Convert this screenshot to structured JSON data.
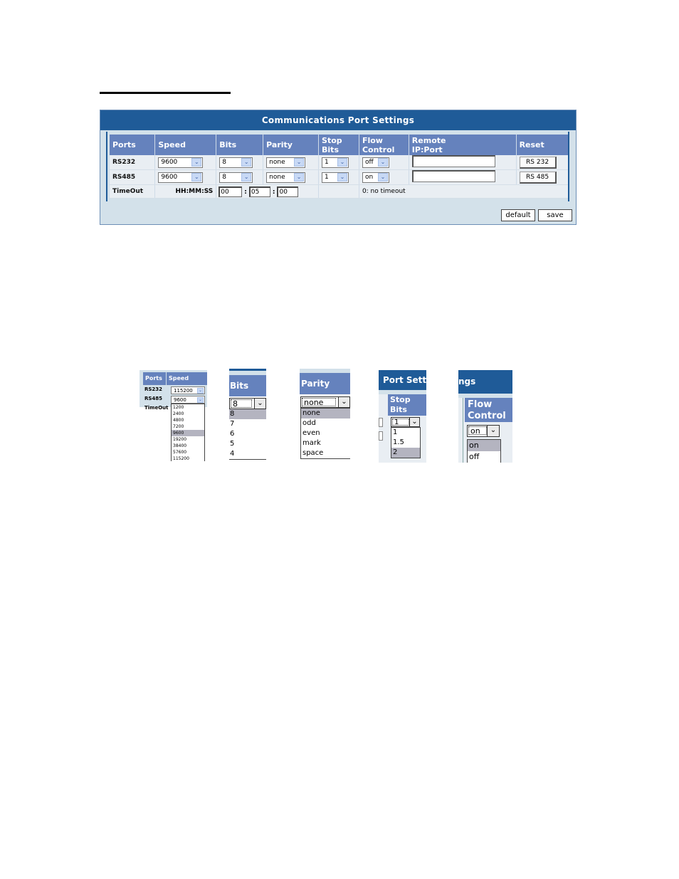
{
  "panel": {
    "title": "Communications Port Settings",
    "columns": [
      "Ports",
      "Speed",
      "Bits",
      "Parity",
      "Stop\nBits",
      "Flow\nControl",
      "Remote\nIP:Port",
      "Reset"
    ],
    "col_lines": {
      "stop": [
        "Stop",
        "Bits"
      ],
      "flow": [
        "Flow",
        "Control"
      ],
      "remote": [
        "Remote",
        "IP:Port"
      ]
    },
    "rows": [
      {
        "port": "RS232",
        "speed": "9600",
        "bits": "8",
        "parity": "none",
        "stop_bits": "1",
        "flow_control": "off",
        "remote_ip_port": "",
        "reset_label": "RS 232"
      },
      {
        "port": "RS485",
        "speed": "9600",
        "bits": "8",
        "parity": "none",
        "stop_bits": "1",
        "flow_control": "on",
        "remote_ip_port": "",
        "reset_label": "RS 485"
      }
    ],
    "timeout": {
      "label": "TimeOut",
      "format": "HH:MM:SS",
      "hh": "00",
      "mm": "05",
      "ss": "00",
      "separator": ":",
      "note": "0: no timeout"
    },
    "buttons": {
      "default": "default",
      "save": "save"
    }
  },
  "dropdown_examples": {
    "speed": {
      "header_ports": "Ports",
      "header_speed": "Speed",
      "rows": [
        {
          "port": "RS232",
          "value": "115200"
        },
        {
          "port": "RS485",
          "value": "9600"
        },
        {
          "port": "TimeOut",
          "value": ""
        }
      ],
      "options": [
        "1200",
        "2400",
        "4800",
        "7200",
        "9600",
        "19200",
        "38400",
        "57600",
        "115200"
      ],
      "highlighted": "9600"
    },
    "bits": {
      "header": "Bits",
      "value": "8",
      "options": [
        "8",
        "7",
        "6",
        "5",
        "4"
      ],
      "highlighted": "8"
    },
    "parity": {
      "header": "Parity",
      "value": "none",
      "options": [
        "none",
        "odd",
        "even",
        "mark",
        "space"
      ],
      "highlighted": "none"
    },
    "stop_bits": {
      "title_fragment": "Port Settin",
      "header": [
        "Stop",
        "Bits"
      ],
      "value": "1",
      "options": [
        "1",
        "1.5",
        "2"
      ],
      "highlighted": "2"
    },
    "flow_control": {
      "title_fragment": "ngs",
      "header": [
        "Flow",
        "Control"
      ],
      "value": "on",
      "options": [
        "on",
        "off"
      ],
      "highlighted": "on"
    }
  },
  "icons": {
    "dropdown_arrow": "chevron-down-icon"
  }
}
